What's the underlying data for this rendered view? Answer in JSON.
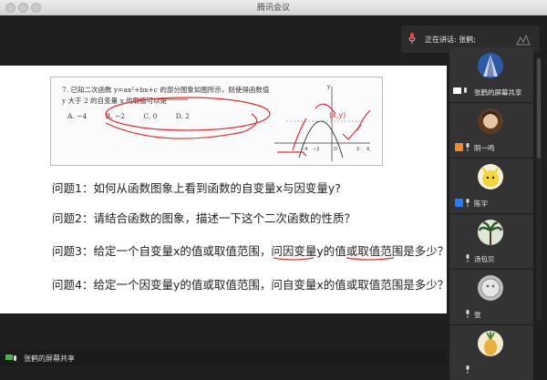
{
  "window": {
    "title": "腾讯会议"
  },
  "speaking": {
    "prefix": "正在讲话:",
    "name": "张鹤;"
  },
  "problem": {
    "line1": "7. 已知二次函数 y=ax²+bx+c 的部分图象如图所示，则使得函数值",
    "line2": "y 大于 2 的自变量 x 的取值可以是",
    "options": [
      "A. −4",
      "B. −2",
      "C. 0",
      "D. 2"
    ],
    "graph_labels": {
      "y": "y",
      "x": "x",
      "point": "(x,y)",
      "ticks": [
        "−4",
        "−2",
        "O",
        "2"
      ]
    }
  },
  "questions": [
    "问题1：如何从函数图象上看到函数的自变量x与因变量y?",
    "问题2：请结合函数的图象，描述一下这个二次函数的性质？",
    "问题3：给定一个自变量x的值或取值范围，问因变量y的值或取值范围是多少？",
    "问题4：给定一个因变量y的值或取值范围，问自变量x的值或取值范围是多少？"
  ],
  "bottom_bar": {
    "label": "张鹤的屏幕共享"
  },
  "participants": [
    {
      "name": "张鹤的屏幕共享",
      "avatar": "spiral-building",
      "badge_color": "#ffffff"
    },
    {
      "name": "阴一鸣",
      "avatar": "anime-character",
      "badge_color": "#f28a30"
    },
    {
      "name": "陈宇",
      "avatar": "pikachu",
      "badge_color": "#2d7bf0"
    },
    {
      "name": "汤包贝",
      "avatar": "palm-tree",
      "badge_color": ""
    },
    {
      "name": "张",
      "avatar": "gray-sticker",
      "badge_color": ""
    },
    {
      "name": "",
      "avatar": "pineapple",
      "badge_color": ""
    }
  ]
}
